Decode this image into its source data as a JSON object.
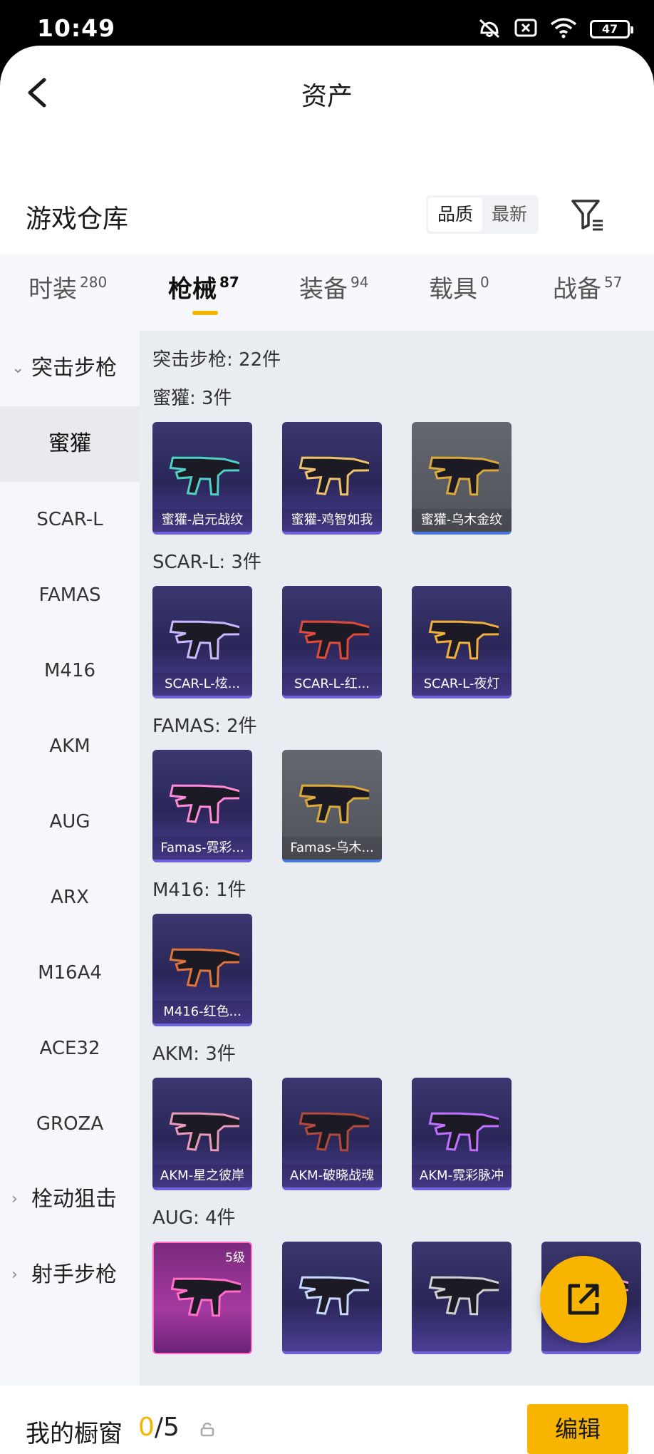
{
  "status": {
    "time": "10:49",
    "battery": "47"
  },
  "header": {
    "title": "资产"
  },
  "warehouse": {
    "title": "游戏仓库",
    "sort_options": [
      "品质",
      "最新"
    ]
  },
  "tabs": [
    {
      "label": "时装",
      "count": "280"
    },
    {
      "label": "枪械",
      "count": "87"
    },
    {
      "label": "装备",
      "count": "94"
    },
    {
      "label": "载具",
      "count": "0"
    },
    {
      "label": "战备",
      "count": "57"
    }
  ],
  "sidebar": {
    "groups": [
      {
        "label": "突击步枪",
        "expanded": true
      },
      {
        "label": "栓动狙击",
        "expanded": false
      },
      {
        "label": "射手步枪",
        "expanded": false
      }
    ],
    "items": [
      "蜜獾",
      "SCAR-L",
      "FAMAS",
      "M416",
      "AKM",
      "AUG",
      "ARX",
      "M16A4",
      "ACE32",
      "GROZA"
    ]
  },
  "content": {
    "category_total": "突击步枪: 22件",
    "sections": [
      {
        "title": "蜜獾: 3件",
        "items": [
          {
            "label": "蜜獾-启元战纹",
            "style": "purple",
            "accent": "#4fd1c5"
          },
          {
            "label": "蜜獾-鸡智如我",
            "style": "purple",
            "accent": "#f0c36a"
          },
          {
            "label": "蜜獾-乌木金纹",
            "style": "grey",
            "accent": "#d9a93a"
          }
        ]
      },
      {
        "title": "SCAR-L: 3件",
        "items": [
          {
            "label": "SCAR-L-炫...",
            "style": "purple",
            "accent": "#c9b8ff"
          },
          {
            "label": "SCAR-L-红...",
            "style": "purple",
            "accent": "#e04a3a"
          },
          {
            "label": "SCAR-L-夜灯",
            "style": "purple",
            "accent": "#f0b03a"
          }
        ]
      },
      {
        "title": "FAMAS: 2件",
        "items": [
          {
            "label": "Famas-霓彩...",
            "style": "purple",
            "accent": "#ff8ad8"
          },
          {
            "label": "Famas-乌木...",
            "style": "grey",
            "accent": "#d9a93a"
          }
        ]
      },
      {
        "title": "M416: 1件",
        "items": [
          {
            "label": "M416-红色...",
            "style": "purple",
            "accent": "#e0743a"
          }
        ]
      },
      {
        "title": "AKM: 3件",
        "items": [
          {
            "label": "AKM-星之彼岸",
            "style": "purple",
            "accent": "#e89ab8"
          },
          {
            "label": "AKM-破晓战魂",
            "style": "purple",
            "accent": "#b04a3a"
          },
          {
            "label": "AKM-霓彩脉冲",
            "style": "purple",
            "accent": "#c070ff"
          }
        ]
      },
      {
        "title": "AUG: 4件",
        "items": [
          {
            "label": "",
            "badge": "5级",
            "style": "pink",
            "accent": "#ff6ec7"
          },
          {
            "label": "",
            "style": "purple",
            "accent": "#c9d8ff"
          },
          {
            "label": "",
            "style": "purple",
            "accent": "#d0d0d0"
          },
          {
            "label": "",
            "style": "purple",
            "accent": "#ff9ad0"
          }
        ]
      }
    ]
  },
  "bottom": {
    "showcase_label": "我的橱窗",
    "showcase_current": "0",
    "showcase_total": "/5",
    "edit_label": "编辑"
  },
  "colors": {
    "accent": "#f7b500",
    "tab_indicator": "#f5b400"
  }
}
